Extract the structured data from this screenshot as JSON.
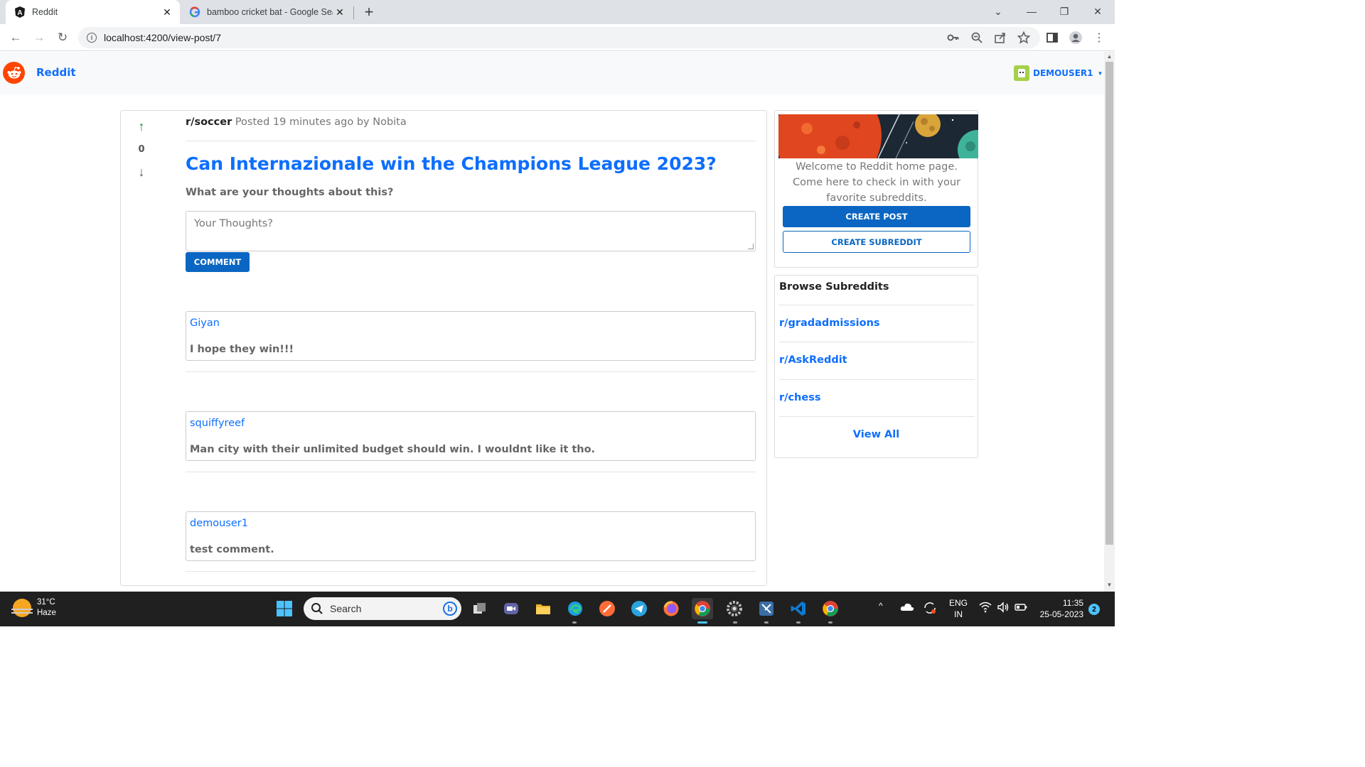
{
  "browser": {
    "tabs": [
      {
        "title": "Reddit",
        "favicon": "angular-icon",
        "active": true
      },
      {
        "title": "bamboo cricket bat - Google Sea",
        "favicon": "google-icon",
        "active": false
      }
    ],
    "url": "localhost:4200/view-post/7"
  },
  "app": {
    "brand": "Reddit",
    "username": "DEMOUSER1"
  },
  "post": {
    "subreddit": "r/soccer",
    "meta": "Posted 19 minutes ago by Nobita",
    "votes": "0",
    "title": "Can Internazionale win the Champions League 2023?",
    "body": "What are your thoughts about this?",
    "comment_placeholder": "Your Thoughts?",
    "comment_button": "COMMENT"
  },
  "comments": [
    {
      "author": "Giyan",
      "text": "I hope they win!!!"
    },
    {
      "author": "squiffyreef",
      "text": "Man city with their unlimited budget should win. I wouldnt like it tho."
    },
    {
      "author": "demouser1",
      "text": "test comment."
    }
  ],
  "sidebar": {
    "welcome": "Welcome to Reddit home page. Come here to check in with your favorite subreddits.",
    "create_post": "CREATE POST",
    "create_subreddit": "CREATE SUBREDDIT",
    "browse_title": "Browse Subreddits",
    "subreddits": [
      "r/gradadmissions",
      "r/AskReddit",
      "r/chess"
    ],
    "view_all": "View All"
  },
  "taskbar": {
    "temperature": "31°C",
    "weather": "Haze",
    "search": "Search",
    "lang1": "ENG",
    "lang2": "IN",
    "time": "11:35",
    "date": "25-05-2023",
    "notifications": "2"
  },
  "colors": {
    "accent": "#0d6efd",
    "button": "#0a66c2",
    "reddit_orange": "#ff4500",
    "upvote": "#1a8a2e"
  }
}
